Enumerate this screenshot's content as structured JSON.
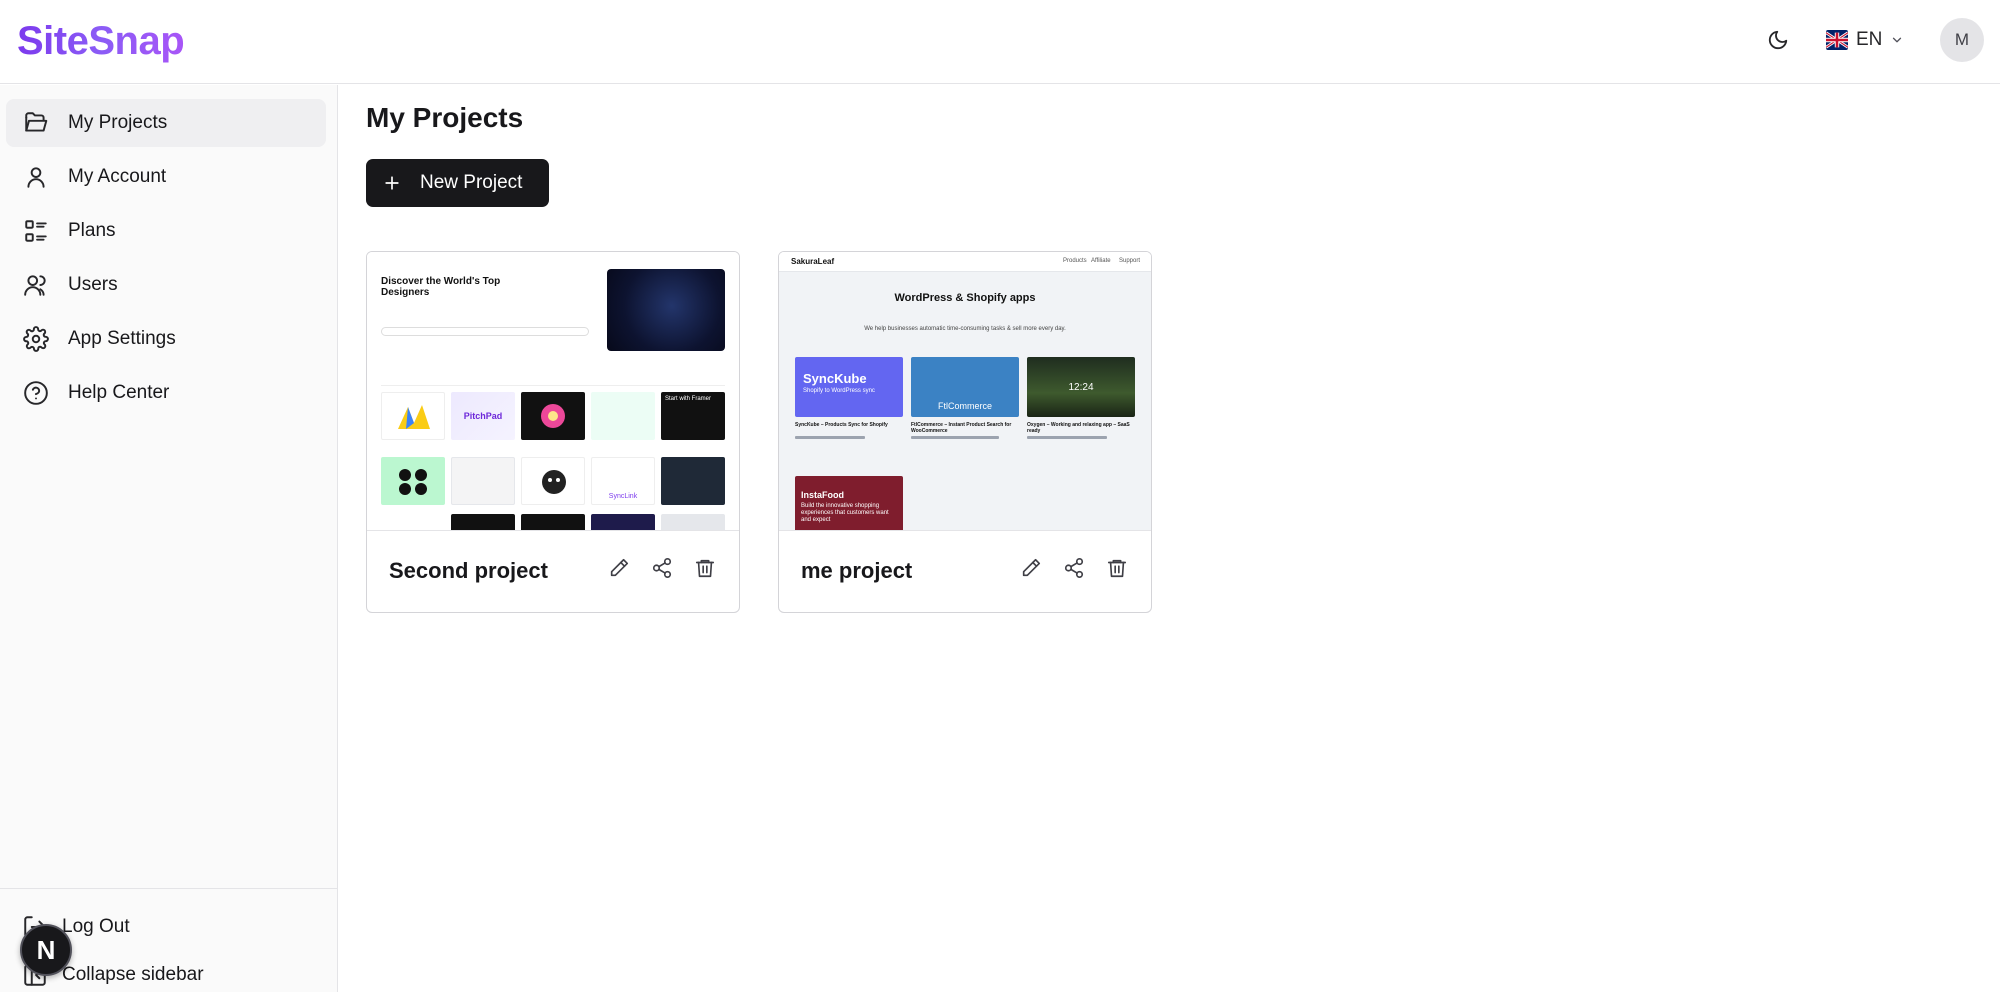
{
  "app": {
    "logo": "SiteSnap"
  },
  "header": {
    "language_code": "EN",
    "avatar_initial": "M"
  },
  "sidebar": {
    "items": [
      {
        "label": "My Projects",
        "icon": "folder-open-icon",
        "active": true
      },
      {
        "label": "My Account",
        "icon": "user-icon",
        "active": false
      },
      {
        "label": "Plans",
        "icon": "list-grid-icon",
        "active": false
      },
      {
        "label": "Users",
        "icon": "users-icon",
        "active": false
      },
      {
        "label": "App Settings",
        "icon": "gear-icon",
        "active": false
      },
      {
        "label": "Help Center",
        "icon": "help-circle-icon",
        "active": false
      }
    ],
    "logout_label": "Log Out",
    "collapse_label": "Collapse sidebar",
    "badge_letter": "N"
  },
  "main": {
    "title": "My Projects",
    "new_project_label": "New Project",
    "projects": [
      {
        "name": "Second project",
        "thumbnail": {
          "headline": "Discover the World's Top Designers",
          "tile_labels": [
            "PitchPad",
            "SyncLink",
            "Start with Framer"
          ]
        }
      },
      {
        "name": "me project",
        "thumbnail": {
          "brand": "SakuraLeaf",
          "nav": [
            "Products",
            "Affiliate",
            "Support"
          ],
          "headline": "WordPress & Shopify apps",
          "subline": "We help businesses automatic time-consuming tasks & sell more every day.",
          "tiles": [
            "SyncKube",
            "FtlCommerce",
            "12:24",
            "InstaFood"
          ],
          "syncube_sub": "Shopify to WordPress sync",
          "instafood_sub": "Build the innovative shopping experiences that customers want and expect",
          "captions": [
            "SyncKube – Products Sync for Shopify",
            "FtlCommerce – Instant Product Search for WooCommerce",
            "Oxygen – Working and relaxing app – SaaS ready"
          ]
        }
      }
    ]
  },
  "colors": {
    "brand": "#7c3aed",
    "button_dark": "#18181b",
    "sidebar_bg": "#fafafa",
    "active_item_bg": "#efeff1"
  }
}
